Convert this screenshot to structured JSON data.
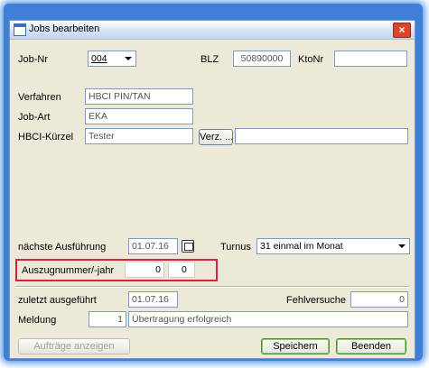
{
  "window": {
    "title": "Jobs bearbeiten",
    "close_glyph": "×"
  },
  "row1": {
    "job_nr_label": "Job-Nr",
    "job_nr_value": "004",
    "blz_label": "BLZ",
    "blz_value": "50890000",
    "ktonr_label": "KtoNr",
    "ktonr_value": ""
  },
  "verfahren": {
    "label": "Verfahren",
    "value": "HBCI PIN/TAN"
  },
  "job_art": {
    "label": "Job-Art",
    "value": "EKA"
  },
  "hbci_kuerzel": {
    "label": "HBCI-Kürzel",
    "value": "Tester",
    "verz_button": "Verz. ...",
    "extra_value": ""
  },
  "naechste": {
    "label": "nächste Ausführung",
    "value": "01.07.16",
    "turnus_label": "Turnus",
    "turnus_value": "31 einmal im Monat"
  },
  "auszug": {
    "label": "Auszugnummer/-jahr",
    "nummer": "0",
    "jahr": "0"
  },
  "zuletzt": {
    "label": "zuletzt ausgeführt",
    "value": "01.07.16",
    "fehlversuche_label": "Fehlversuche",
    "fehlversuche_value": "0"
  },
  "meldung": {
    "label": "Meldung",
    "nr": "1",
    "text": "Übertragung erfolgreich"
  },
  "buttons": {
    "auftraege": "Aufträge anzeigen",
    "speichern": "Speichern",
    "beenden": "Beenden"
  },
  "colors": {
    "highlight": "#d9213b",
    "window_bg": "#ece9d8",
    "frame_blue": "#3f7fd6"
  },
  "icons": {
    "calendar": "calendar-icon",
    "close": "close-icon",
    "window": "window-icon"
  }
}
